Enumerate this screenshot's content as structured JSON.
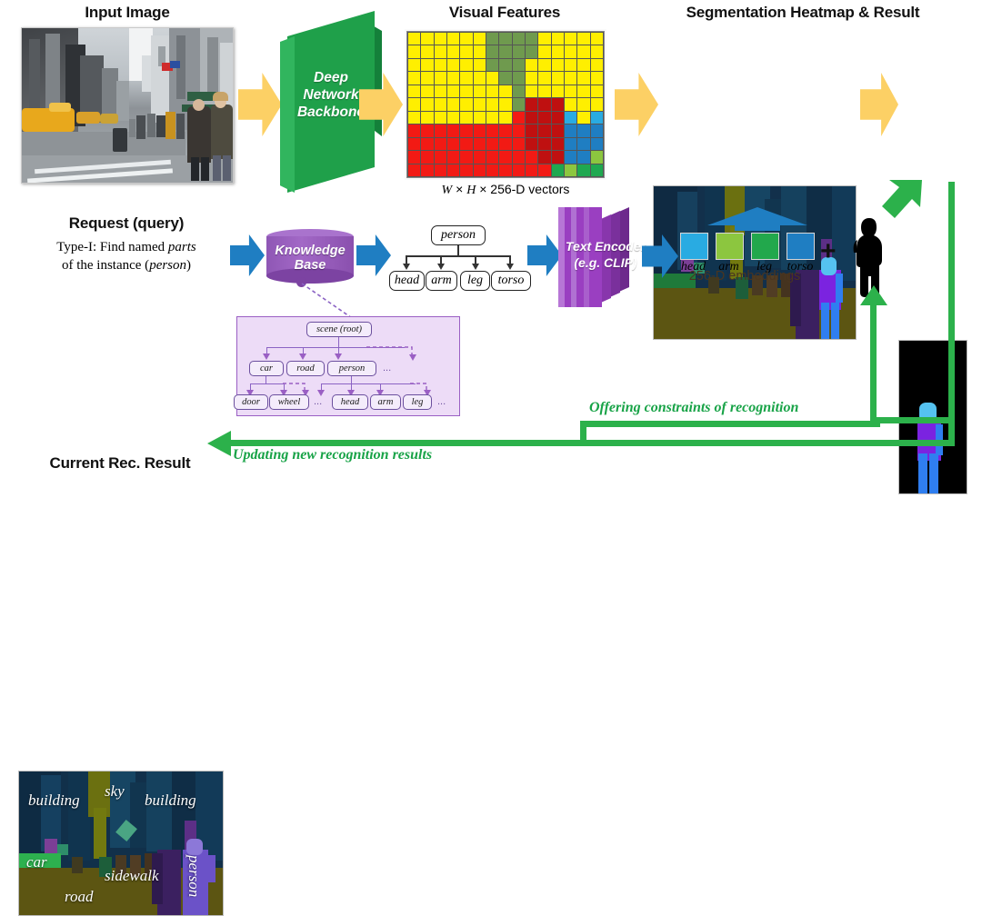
{
  "figure": {
    "title_input": "Input Image",
    "title_features": "Visual Features",
    "title_segmentation": "Segmentation Heatmap & Result",
    "title_request": "Request (query)",
    "title_current_result": "Current Rec. Result"
  },
  "backbone": {
    "line1": "Deep",
    "line2": "Network",
    "line3": "Backbone"
  },
  "features": {
    "caption_w": "W",
    "caption_times1": "×",
    "caption_h": "H",
    "caption_times2": "×",
    "caption_rest": "256-D vectors",
    "full_caption": "W × H × 256-D vectors",
    "colors": {
      "yellow": "#ffef00",
      "red": "#f21a14",
      "dark_red": "#bf1010",
      "olive_green": "#6f9a4e",
      "blue": "#1f7ec2",
      "cyan": "#29abe2",
      "green": "#1fa850",
      "light_green": "#8cc63f"
    },
    "cols": 15,
    "rows": 11
  },
  "request": {
    "line1_pre": "Type-I: Find named ",
    "line1_em": "parts",
    "line2_pre": "of the instance (",
    "line2_em": "person",
    "line2_post": ")"
  },
  "knowledge_base": {
    "line1": "Knowledge",
    "line2": "Base"
  },
  "text_encoder": {
    "line1": "Text Encoder",
    "line2": "(e.g. CLIP)"
  },
  "person_tree": {
    "root": "person",
    "children": [
      "head",
      "arm",
      "leg",
      "torso"
    ]
  },
  "kb_tree": {
    "root": "scene (root)",
    "level1": [
      "car",
      "road",
      "person",
      "..."
    ],
    "car_children": [
      "door",
      "wheel",
      "..."
    ],
    "person_children": [
      "head",
      "arm",
      "leg",
      "..."
    ]
  },
  "embeddings": {
    "caption": "256-D embeddings",
    "items": [
      {
        "label": "head",
        "color": "#29abe2"
      },
      {
        "label": "arm",
        "color": "#8cc63f"
      },
      {
        "label": "leg",
        "color": "#22a84c"
      },
      {
        "label": "torso",
        "color": "#1f7ec2"
      }
    ],
    "plus": "+"
  },
  "seg_labels": {
    "building_left": "building",
    "sky": "sky",
    "building_right": "building",
    "car": "car",
    "sidewalk": "sidewalk",
    "road": "road",
    "person": "person"
  },
  "feedback": {
    "offering": "Offering constraints of recognition",
    "updating": "Updating new recognition results",
    "color": "#18a347"
  },
  "palette": {
    "yellow_arrow": "#fcd065",
    "blue_arrow": "#1f7ec2",
    "backbone_green": "#21a94a",
    "encoder_purple": "#8e3fb0",
    "kb_purple": "#9a5fc4"
  }
}
